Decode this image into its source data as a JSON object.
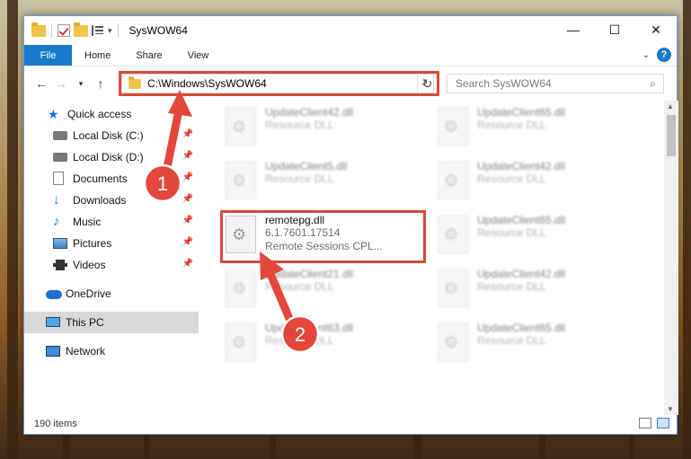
{
  "window": {
    "title": "SysWOW64"
  },
  "ribbon": {
    "tabs": [
      "File",
      "Home",
      "Share",
      "View"
    ]
  },
  "address": {
    "path": "C:\\Windows\\SysWOW64"
  },
  "search": {
    "placeholder": "Search SysWOW64"
  },
  "sidebar": {
    "items": [
      {
        "label": "Quick access"
      },
      {
        "label": "Local Disk (C:)"
      },
      {
        "label": "Local Disk (D:)"
      },
      {
        "label": "Documents"
      },
      {
        "label": "Downloads"
      },
      {
        "label": "Music"
      },
      {
        "label": "Pictures"
      },
      {
        "label": "Videos"
      },
      {
        "label": "OneDrive"
      },
      {
        "label": "This PC"
      },
      {
        "label": "Network"
      }
    ]
  },
  "files": [
    {
      "name": "UpdateClient42.dll",
      "line1": "Resource DLL"
    },
    {
      "name": "UpdateClient65.dll",
      "line1": "Resource DLL"
    },
    {
      "name": "UpdateClient5.dll",
      "line1": "Resource DLL"
    },
    {
      "name": "UpdateClient42.dll",
      "line1": "Resource DLL"
    },
    {
      "name": "remotepg.dll",
      "line1": "6.1.7601.17514",
      "line2": "Remote Sessions CPL..."
    },
    {
      "name": "UpdateClient65.dll",
      "line1": "Resource DLL"
    },
    {
      "name": "UpdateClient21.dll",
      "line1": "Resource DLL"
    },
    {
      "name": "UpdateClient42.dll",
      "line1": "Resource DLL"
    },
    {
      "name": "UpdateClient63.dll",
      "line1": "Resource DLL"
    },
    {
      "name": "UpdateClient65.dll",
      "line1": "Resource DLL"
    }
  ],
  "status": {
    "count": "190 items"
  },
  "annotations": {
    "step1": "1",
    "step2": "2"
  },
  "colors": {
    "accent": "#1979ca",
    "highlight": "#d9473a"
  }
}
